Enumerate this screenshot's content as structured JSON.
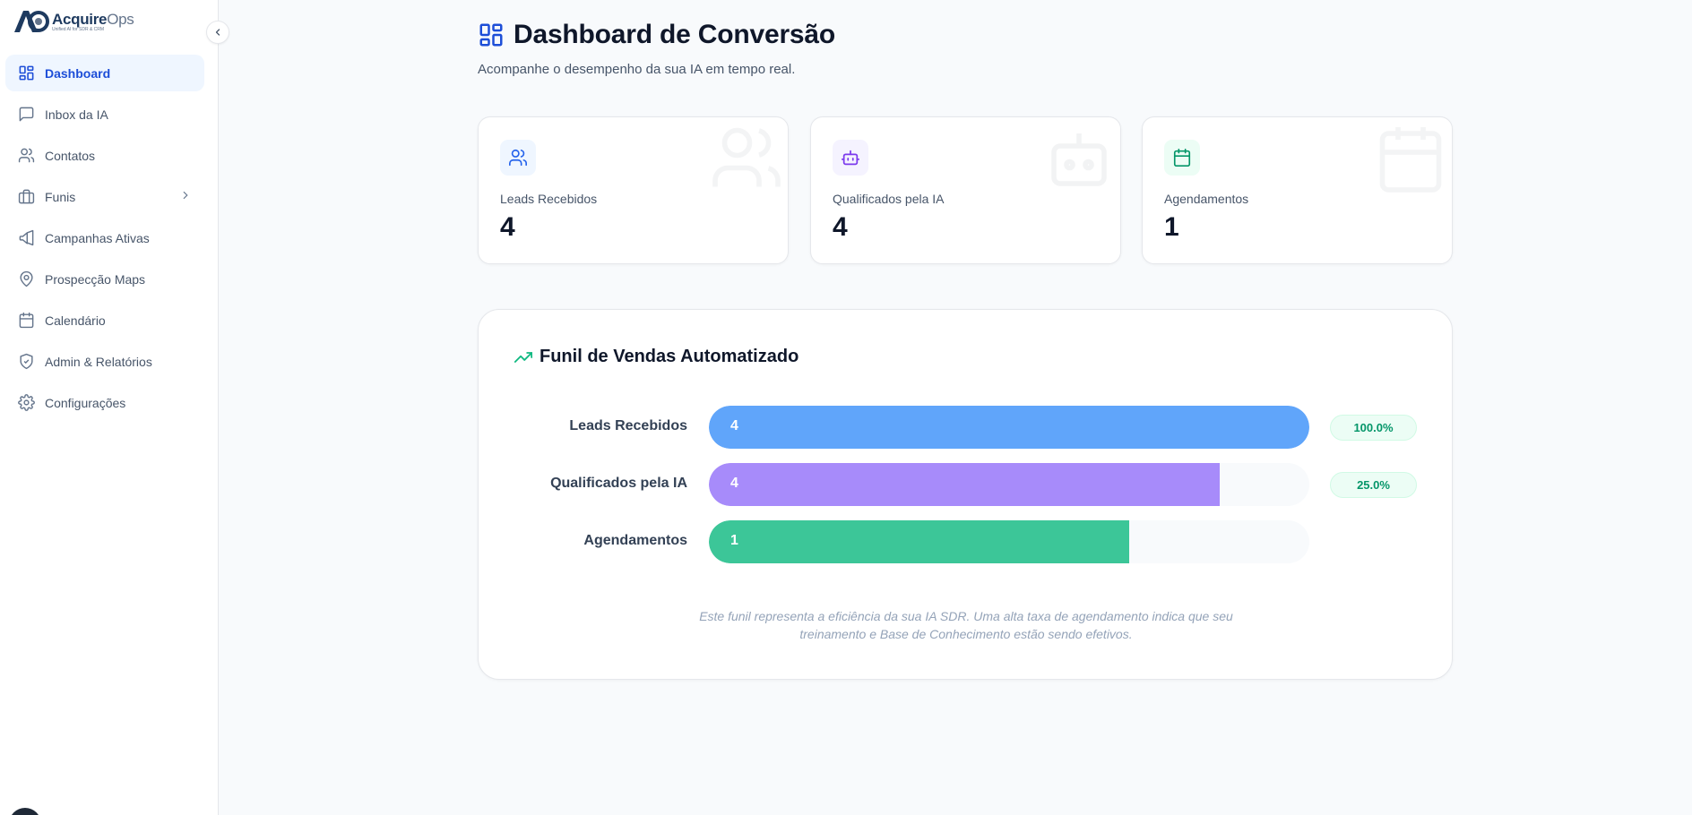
{
  "brand": {
    "name": "Acquire",
    "name_suffix": "Ops",
    "tagline": "Unified AI for SDR & CRM"
  },
  "sidebar": {
    "items": [
      {
        "label": "Dashboard",
        "icon": "layout-grid-icon",
        "active": true
      },
      {
        "label": "Inbox da IA",
        "icon": "message-square-icon"
      },
      {
        "label": "Contatos",
        "icon": "users-icon"
      },
      {
        "label": "Funis",
        "icon": "briefcase-icon",
        "has_submenu": true
      },
      {
        "label": "Campanhas Ativas",
        "icon": "megaphone-icon"
      },
      {
        "label": "Prospecção Maps",
        "icon": "map-pin-icon"
      },
      {
        "label": "Calendário",
        "icon": "calendar-icon"
      },
      {
        "label": "Admin & Relatórios",
        "icon": "shield-check-icon"
      },
      {
        "label": "Configurações",
        "icon": "settings-icon"
      }
    ]
  },
  "header": {
    "title": "Dashboard de Conversão",
    "subtitle": "Acompanhe o desempenho da sua IA em tempo real."
  },
  "stats": [
    {
      "label": "Leads Recebidos",
      "value": "4",
      "icon": "users-icon",
      "color": "#2563eb",
      "bg": "#eff6ff"
    },
    {
      "label": "Qualificados pela IA",
      "value": "4",
      "icon": "bot-icon",
      "color": "#7c3aed",
      "bg": "#f5f3ff"
    },
    {
      "label": "Agendamentos",
      "value": "1",
      "icon": "calendar-icon",
      "color": "#059669",
      "bg": "#ecfdf5"
    }
  ],
  "funnel": {
    "title": "Funil de Vendas Automatizado",
    "rows": [
      {
        "label": "Leads Recebidos",
        "value": "4",
        "fill_fraction": 1.0,
        "color": "#60a5fa",
        "badge": "100.0%"
      },
      {
        "label": "Qualificados pela IA",
        "value": "4",
        "fill_fraction": 0.85,
        "color": "#a78bfa",
        "badge": "25.0%"
      },
      {
        "label": "Agendamentos",
        "value": "1",
        "fill_fraction": 0.7,
        "color": "#3cc698",
        "badge": ""
      }
    ],
    "note_line1": "Este funil representa a eficiência da sua IA SDR. Uma alta taxa de agendamento indica que seu",
    "note_line2": "treinamento e Base de Conhecimento estão sendo efetivos."
  }
}
